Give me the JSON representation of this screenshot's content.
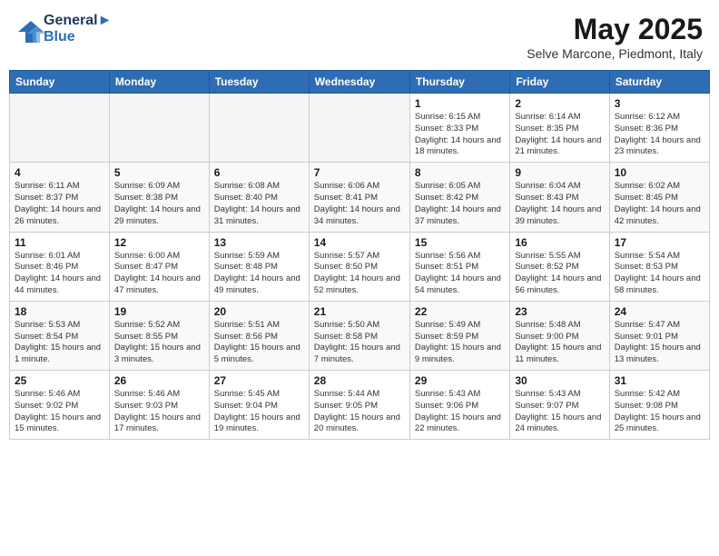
{
  "header": {
    "logo_line1": "General",
    "logo_line2": "Blue",
    "month": "May 2025",
    "location": "Selve Marcone, Piedmont, Italy"
  },
  "days_of_week": [
    "Sunday",
    "Monday",
    "Tuesday",
    "Wednesday",
    "Thursday",
    "Friday",
    "Saturday"
  ],
  "weeks": [
    [
      {
        "day": "",
        "empty": true
      },
      {
        "day": "",
        "empty": true
      },
      {
        "day": "",
        "empty": true
      },
      {
        "day": "",
        "empty": true
      },
      {
        "day": "1",
        "sunrise": "6:15 AM",
        "sunset": "8:33 PM",
        "daylight": "14 hours and 18 minutes."
      },
      {
        "day": "2",
        "sunrise": "6:14 AM",
        "sunset": "8:35 PM",
        "daylight": "14 hours and 21 minutes."
      },
      {
        "day": "3",
        "sunrise": "6:12 AM",
        "sunset": "8:36 PM",
        "daylight": "14 hours and 23 minutes."
      }
    ],
    [
      {
        "day": "4",
        "sunrise": "6:11 AM",
        "sunset": "8:37 PM",
        "daylight": "14 hours and 26 minutes."
      },
      {
        "day": "5",
        "sunrise": "6:09 AM",
        "sunset": "8:38 PM",
        "daylight": "14 hours and 29 minutes."
      },
      {
        "day": "6",
        "sunrise": "6:08 AM",
        "sunset": "8:40 PM",
        "daylight": "14 hours and 31 minutes."
      },
      {
        "day": "7",
        "sunrise": "6:06 AM",
        "sunset": "8:41 PM",
        "daylight": "14 hours and 34 minutes."
      },
      {
        "day": "8",
        "sunrise": "6:05 AM",
        "sunset": "8:42 PM",
        "daylight": "14 hours and 37 minutes."
      },
      {
        "day": "9",
        "sunrise": "6:04 AM",
        "sunset": "8:43 PM",
        "daylight": "14 hours and 39 minutes."
      },
      {
        "day": "10",
        "sunrise": "6:02 AM",
        "sunset": "8:45 PM",
        "daylight": "14 hours and 42 minutes."
      }
    ],
    [
      {
        "day": "11",
        "sunrise": "6:01 AM",
        "sunset": "8:46 PM",
        "daylight": "14 hours and 44 minutes."
      },
      {
        "day": "12",
        "sunrise": "6:00 AM",
        "sunset": "8:47 PM",
        "daylight": "14 hours and 47 minutes."
      },
      {
        "day": "13",
        "sunrise": "5:59 AM",
        "sunset": "8:48 PM",
        "daylight": "14 hours and 49 minutes."
      },
      {
        "day": "14",
        "sunrise": "5:57 AM",
        "sunset": "8:50 PM",
        "daylight": "14 hours and 52 minutes."
      },
      {
        "day": "15",
        "sunrise": "5:56 AM",
        "sunset": "8:51 PM",
        "daylight": "14 hours and 54 minutes."
      },
      {
        "day": "16",
        "sunrise": "5:55 AM",
        "sunset": "8:52 PM",
        "daylight": "14 hours and 56 minutes."
      },
      {
        "day": "17",
        "sunrise": "5:54 AM",
        "sunset": "8:53 PM",
        "daylight": "14 hours and 58 minutes."
      }
    ],
    [
      {
        "day": "18",
        "sunrise": "5:53 AM",
        "sunset": "8:54 PM",
        "daylight": "15 hours and 1 minute."
      },
      {
        "day": "19",
        "sunrise": "5:52 AM",
        "sunset": "8:55 PM",
        "daylight": "15 hours and 3 minutes."
      },
      {
        "day": "20",
        "sunrise": "5:51 AM",
        "sunset": "8:56 PM",
        "daylight": "15 hours and 5 minutes."
      },
      {
        "day": "21",
        "sunrise": "5:50 AM",
        "sunset": "8:58 PM",
        "daylight": "15 hours and 7 minutes."
      },
      {
        "day": "22",
        "sunrise": "5:49 AM",
        "sunset": "8:59 PM",
        "daylight": "15 hours and 9 minutes."
      },
      {
        "day": "23",
        "sunrise": "5:48 AM",
        "sunset": "9:00 PM",
        "daylight": "15 hours and 11 minutes."
      },
      {
        "day": "24",
        "sunrise": "5:47 AM",
        "sunset": "9:01 PM",
        "daylight": "15 hours and 13 minutes."
      }
    ],
    [
      {
        "day": "25",
        "sunrise": "5:46 AM",
        "sunset": "9:02 PM",
        "daylight": "15 hours and 15 minutes."
      },
      {
        "day": "26",
        "sunrise": "5:46 AM",
        "sunset": "9:03 PM",
        "daylight": "15 hours and 17 minutes."
      },
      {
        "day": "27",
        "sunrise": "5:45 AM",
        "sunset": "9:04 PM",
        "daylight": "15 hours and 19 minutes."
      },
      {
        "day": "28",
        "sunrise": "5:44 AM",
        "sunset": "9:05 PM",
        "daylight": "15 hours and 20 minutes."
      },
      {
        "day": "29",
        "sunrise": "5:43 AM",
        "sunset": "9:06 PM",
        "daylight": "15 hours and 22 minutes."
      },
      {
        "day": "30",
        "sunrise": "5:43 AM",
        "sunset": "9:07 PM",
        "daylight": "15 hours and 24 minutes."
      },
      {
        "day": "31",
        "sunrise": "5:42 AM",
        "sunset": "9:08 PM",
        "daylight": "15 hours and 25 minutes."
      }
    ]
  ]
}
